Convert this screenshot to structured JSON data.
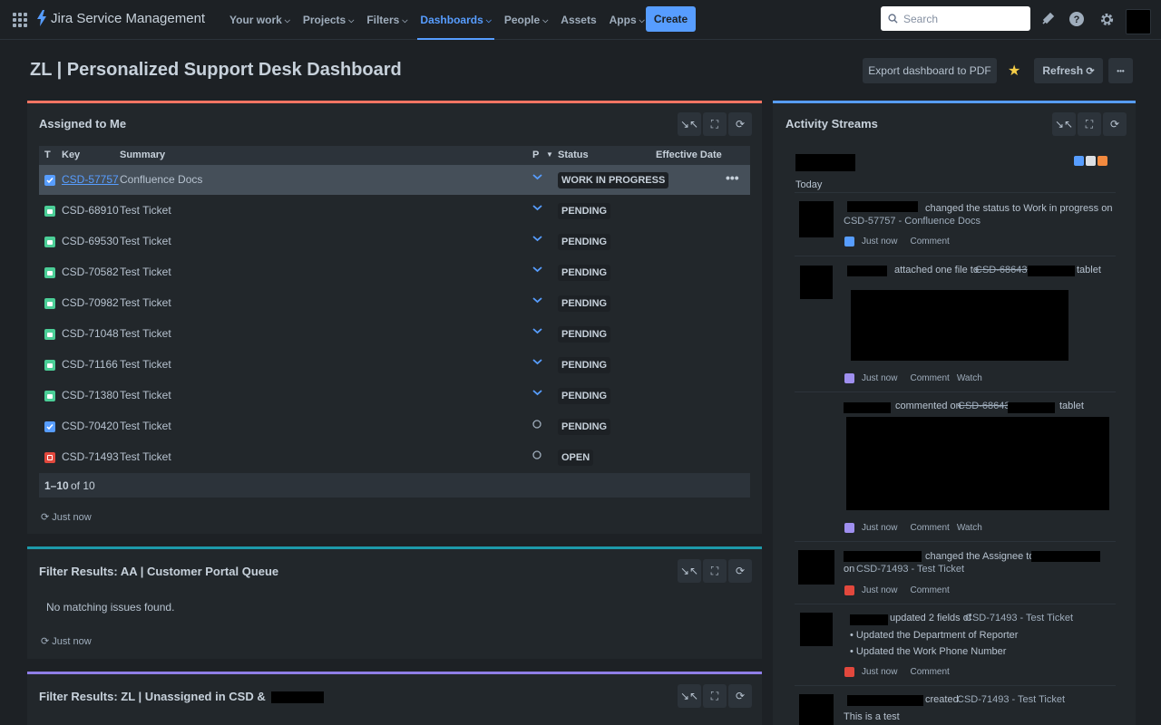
{
  "nav": {
    "product": "Jira Service Management",
    "items": [
      {
        "label": "Your work"
      },
      {
        "label": "Projects"
      },
      {
        "label": "Filters"
      },
      {
        "label": "Dashboards"
      },
      {
        "label": "People"
      },
      {
        "label": "Assets"
      },
      {
        "label": "Apps"
      }
    ],
    "create": "Create",
    "search_placeholder": "Search"
  },
  "page": {
    "title": "ZL | Personalized Support Desk Dashboard",
    "export": "Export dashboard to PDF",
    "refresh": "Refresh",
    "more": "•••"
  },
  "assigned": {
    "title": "Assigned to Me",
    "headers": {
      "t": "T",
      "key": "Key",
      "summary": "Summary",
      "p": "P",
      "status": "Status",
      "effective": "Effective Date"
    },
    "rows": [
      {
        "key": "CSD-57757",
        "summary": "Confluence Docs",
        "status": "WORK IN PROGRESS",
        "type": "task",
        "prio": "low"
      },
      {
        "key": "CSD-68910",
        "summary": "Test Ticket",
        "status": "PENDING",
        "type": "request",
        "prio": "low"
      },
      {
        "key": "CSD-69530",
        "summary": "Test Ticket",
        "status": "PENDING",
        "type": "request",
        "prio": "low"
      },
      {
        "key": "CSD-70582",
        "summary": "Test Ticket",
        "status": "PENDING",
        "type": "request",
        "prio": "low"
      },
      {
        "key": "CSD-70982",
        "summary": "Test Ticket",
        "status": "PENDING",
        "type": "request",
        "prio": "low"
      },
      {
        "key": "CSD-71048",
        "summary": "Test Ticket",
        "status": "PENDING",
        "type": "request",
        "prio": "low"
      },
      {
        "key": "CSD-71166",
        "summary": "Test Ticket",
        "status": "PENDING",
        "type": "request",
        "prio": "low"
      },
      {
        "key": "CSD-71380",
        "summary": "Test Ticket",
        "status": "PENDING",
        "type": "request",
        "prio": "low"
      },
      {
        "key": "CSD-70420",
        "summary": "Test Ticket",
        "status": "PENDING",
        "type": "task",
        "prio": "none"
      },
      {
        "key": "CSD-71493",
        "summary": "Test Ticket",
        "status": "OPEN",
        "type": "incident",
        "prio": "none"
      }
    ],
    "pager_range": "1–10",
    "pager_of": "of 10",
    "refreshed": "Just now"
  },
  "portal": {
    "title": "Filter Results: AA | Customer Portal Queue",
    "empty": "No matching issues found.",
    "refreshed": "Just now"
  },
  "unassigned": {
    "title": "Filter Results: ZL | Unassigned in CSD &"
  },
  "activity": {
    "title": "Activity Streams",
    "today": "Today",
    "e1_action": "changed the status to Work in progress on",
    "e1_target": "CSD-57757 - Confluence Docs",
    "e2_action": "attached one file to",
    "e2_key": "CSD-68643",
    "e2_suffix": "tablet",
    "e3_action": "commented on",
    "e3_key": "CSD-68643",
    "e3_suffix": "tablet",
    "e4_action": "changed the Assignee to '",
    "e4_on": "on",
    "e4_target": "CSD-71493 - Test Ticket",
    "e5_action": "updated 2 fields of",
    "e5_target": "CSD-71493 - Test Ticket",
    "e5_f1": "Updated the Department of Reporter",
    "e5_f2": "Updated the Work Phone Number",
    "e6_action": "created",
    "e6_target": "CSD-71493 - Test Ticket",
    "e6_body": "This is a test",
    "just_now": "Just now",
    "comment": "Comment",
    "watch": "Watch"
  },
  "colors": {
    "accent": "#579dff",
    "gadget1_top": "#f87462",
    "gadget2_top": "#1d9aaa",
    "gadget3_top": "#8f7ee7",
    "activity_top": "#579dff"
  }
}
